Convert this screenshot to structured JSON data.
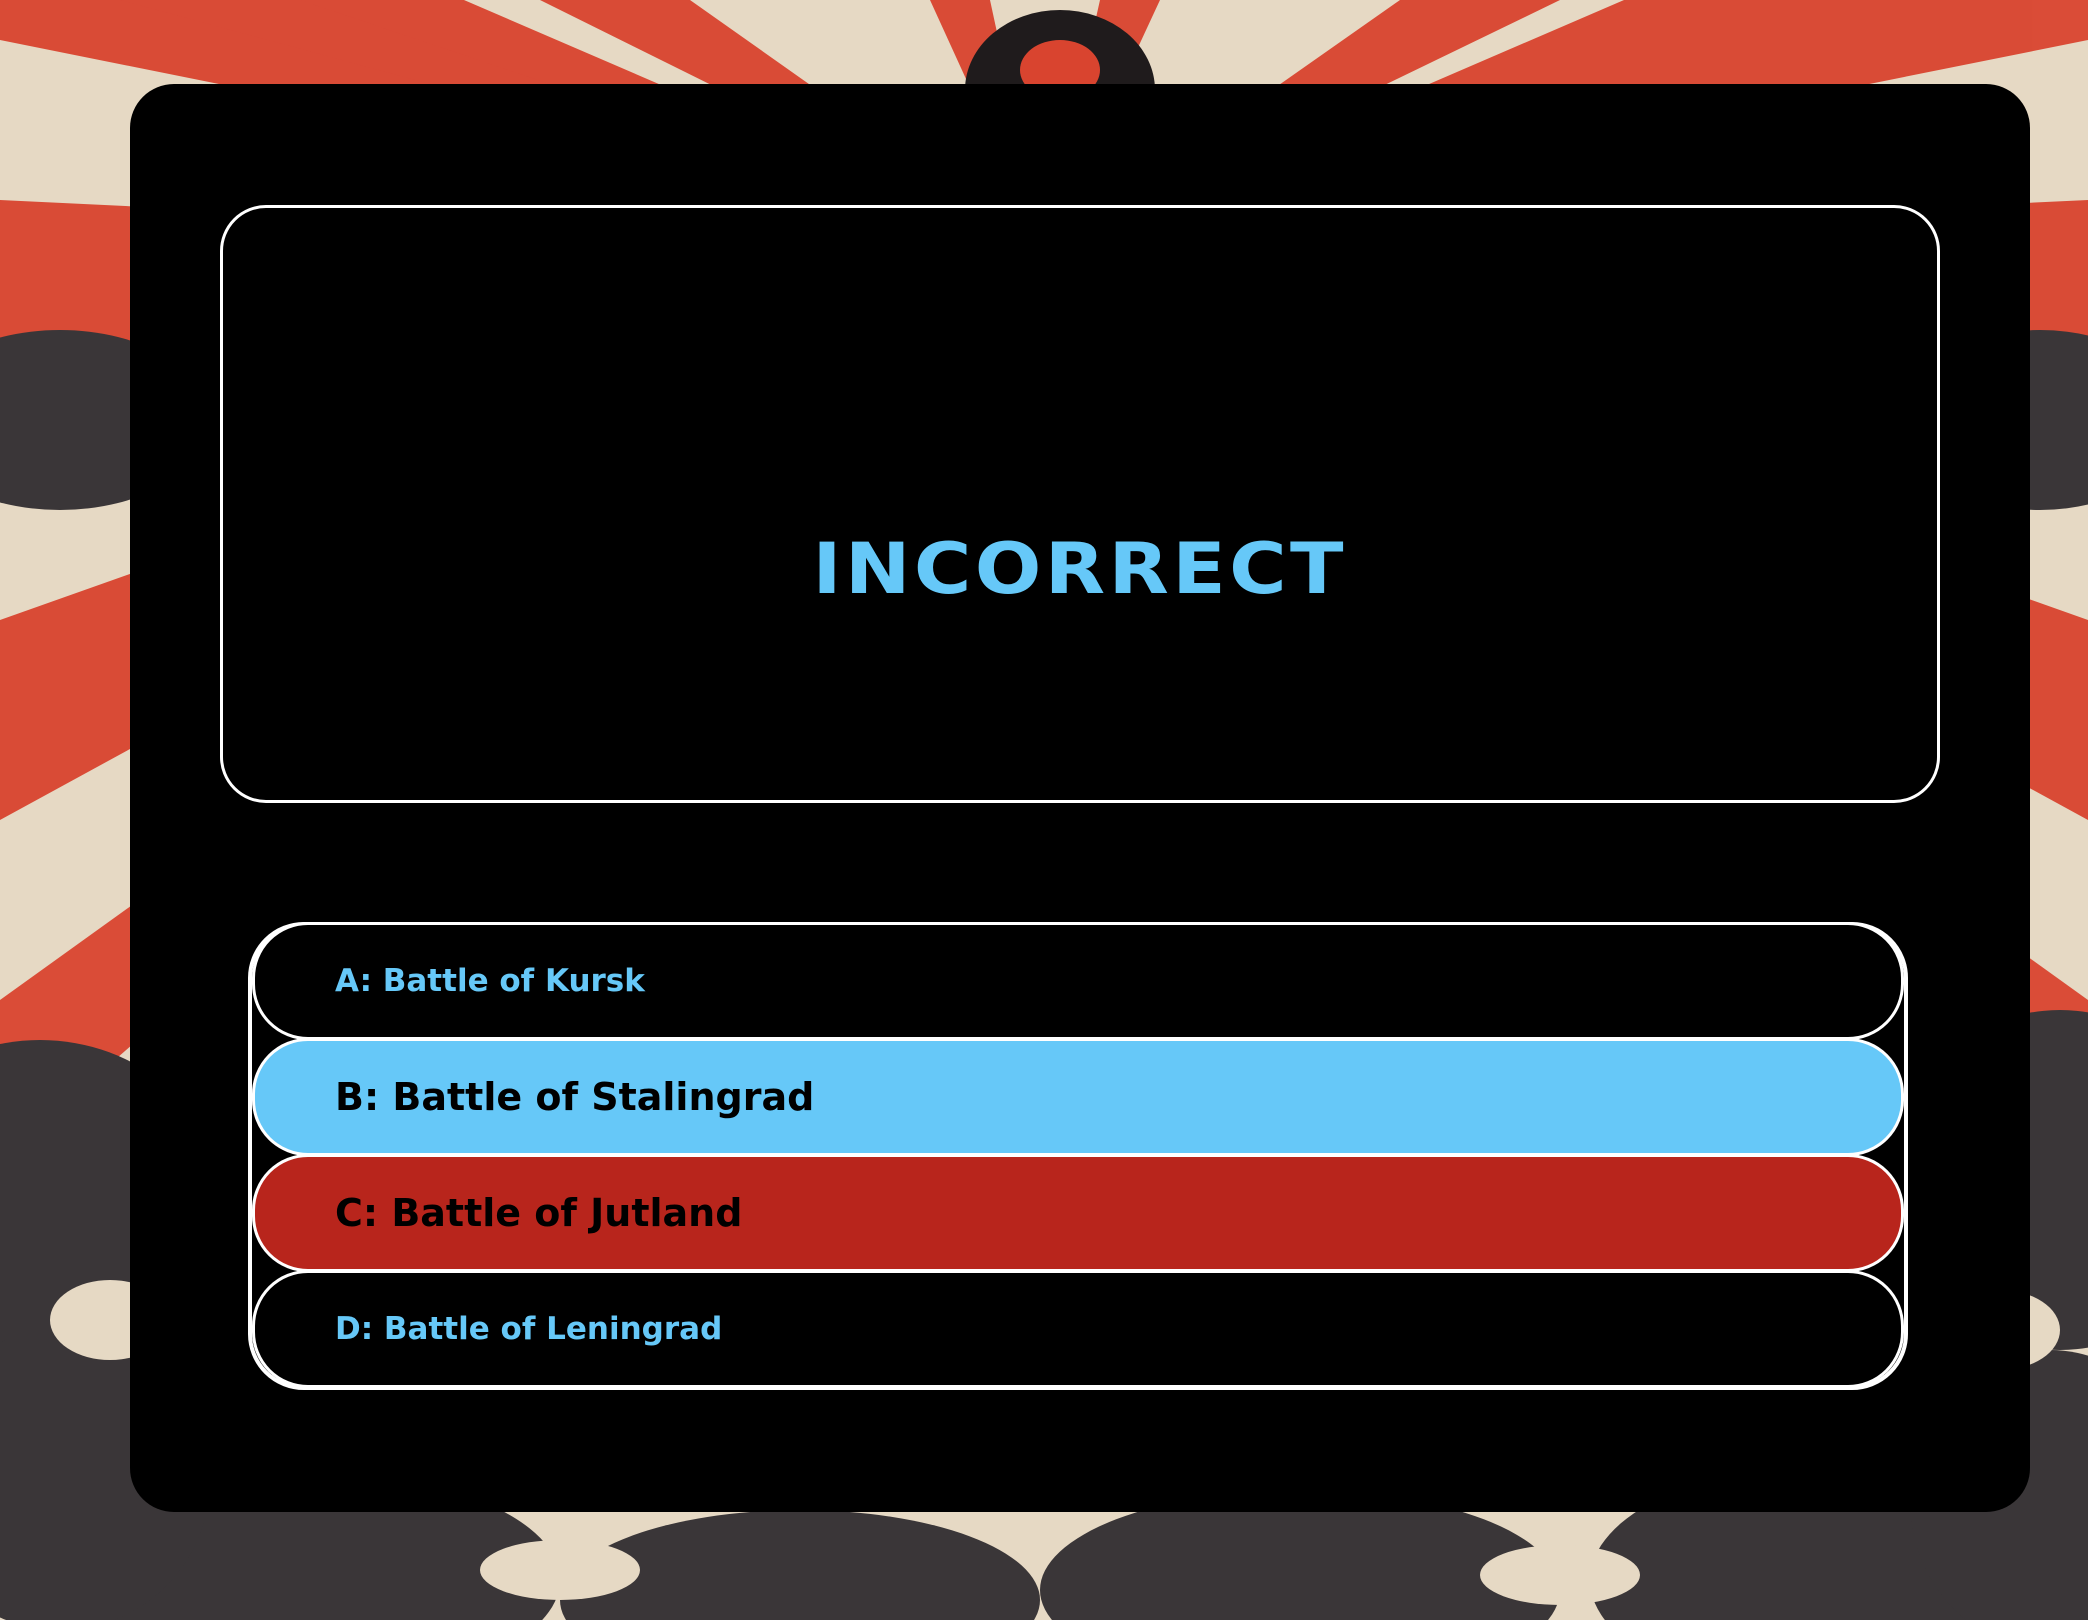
{
  "result": {
    "text": "INCORRECT",
    "color": "#66c8f8"
  },
  "answers": [
    {
      "label": "A: Battle of Kursk",
      "state": "default"
    },
    {
      "label": "B: Battle of Stalingrad",
      "state": "correct"
    },
    {
      "label": "C: Battle of Jutland",
      "state": "selected-wrong"
    },
    {
      "label": "D: Battle of Leningrad",
      "state": "default"
    }
  ],
  "colors": {
    "panel": "#000000",
    "accent_blue": "#66c8f8",
    "wrong_red": "#b8251c",
    "border": "#ffffff",
    "poster_red": "#d9442f",
    "poster_cream": "#e8dcc8",
    "poster_dark": "#3a3638"
  }
}
